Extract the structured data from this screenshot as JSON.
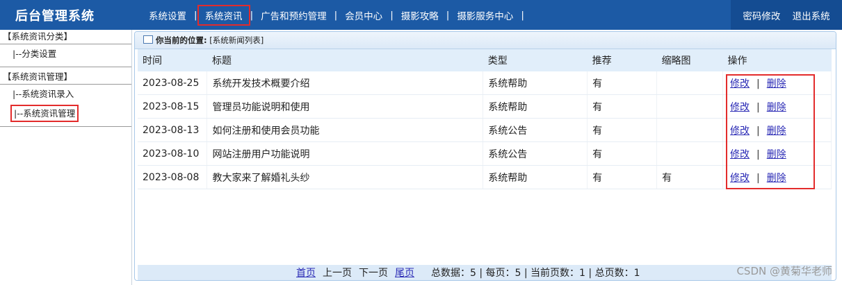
{
  "header": {
    "title": "后台管理系统"
  },
  "nav": [
    {
      "label": "系统设置"
    },
    {
      "label": "系统资讯"
    },
    {
      "label": "广告和预约管理"
    },
    {
      "label": "会员中心"
    },
    {
      "label": "摄影攻略"
    },
    {
      "label": "摄影服务中心"
    }
  ],
  "nav_sep": "|",
  "right_nav": {
    "change_password": "密码修改",
    "logout": "退出系统"
  },
  "sidebar": {
    "group1": {
      "title": "【系统资讯分类】",
      "items": [
        {
          "label": "|--分类设置"
        }
      ]
    },
    "group2": {
      "title": "【系统资讯管理】",
      "items": [
        {
          "label": "|--系统资讯录入"
        },
        {
          "label": "|--系统资讯管理"
        }
      ]
    }
  },
  "breadcrumb": {
    "prefix": "你当前的位置:",
    "location": "[系统新闻列表]"
  },
  "table": {
    "headers": [
      "时间",
      "标题",
      "类型",
      "推荐",
      "缩略图",
      "操作"
    ],
    "rows": [
      {
        "time": "2023-08-25",
        "title": "系统开发技术概要介绍",
        "type": "系统帮助",
        "recommend": "有",
        "thumb": "",
        "edit": "修改",
        "sep": "|",
        "del": "删除"
      },
      {
        "time": "2023-08-15",
        "title": "管理员功能说明和使用",
        "type": "系统帮助",
        "recommend": "有",
        "thumb": "",
        "edit": "修改",
        "sep": "|",
        "del": "删除"
      },
      {
        "time": "2023-08-13",
        "title": "如何注册和使用会员功能",
        "type": "系统公告",
        "recommend": "有",
        "thumb": "",
        "edit": "修改",
        "sep": "|",
        "del": "删除"
      },
      {
        "time": "2023-08-10",
        "title": "网站注册用户功能说明",
        "type": "系统公告",
        "recommend": "有",
        "thumb": "",
        "edit": "修改",
        "sep": "|",
        "del": "删除"
      },
      {
        "time": "2023-08-08",
        "title": "教大家来了解婚礼头纱",
        "type": "系统帮助",
        "recommend": "有",
        "thumb": "有",
        "edit": "修改",
        "sep": "|",
        "del": "删除"
      }
    ]
  },
  "pager": {
    "first": "首页",
    "prev": "上一页",
    "next": "下一页",
    "last": "尾页",
    "stats": "总数据：5 | 每页：5 | 当前页数：1 | 总页数：1"
  },
  "watermark": "CSDN @黄菊华老师",
  "colors": {
    "header": "#1c5aa5",
    "highlight": "#e32b2b",
    "link": "#2a2ab5"
  }
}
